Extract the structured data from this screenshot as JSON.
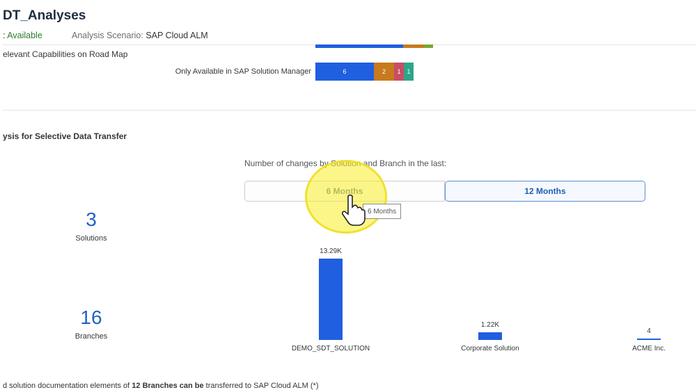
{
  "header": {
    "title": "DT_Analyses",
    "status_prefix": ": ",
    "status_value": "Available",
    "scenario_label": "Analysis Scenario: ",
    "scenario_value": "SAP Cloud ALM"
  },
  "roadmap": {
    "capabilities_label": "elevant Capabilities on Road Map",
    "row_label": "Only Available in SAP Solution Manager",
    "segments": [
      {
        "value": "6",
        "color": "#1f5fe0"
      },
      {
        "value": "2",
        "color": "#c77a1e"
      },
      {
        "value": "1",
        "color": "#c94d63"
      },
      {
        "value": "1",
        "color": "#2ea58a"
      }
    ]
  },
  "section": {
    "title": "ysis for Selective Data Transfer",
    "changes_label": "Number of changes by Solution and Branch in the last:",
    "buttons": {
      "six_months": "6 Months",
      "twelve_months": "12 Months"
    },
    "tooltip": "6 Months"
  },
  "kpis": {
    "solutions": {
      "value": "3",
      "label": "Solutions"
    },
    "branches": {
      "value": "16",
      "label": "Branches"
    }
  },
  "chart_data": {
    "type": "bar",
    "categories": [
      "DEMO_SDT_SOLUTION",
      "Corporate Solution",
      "ACME Inc."
    ],
    "values": [
      13290,
      1220,
      4
    ],
    "value_labels": [
      "13.29K",
      "1.22K",
      "4"
    ],
    "series_color": "#1f5fe0"
  },
  "footer": {
    "text_before": "d solution documentation elements of ",
    "text_bold": "12 Branches can be",
    "text_after": " transferred to SAP Cloud ALM (*)"
  }
}
